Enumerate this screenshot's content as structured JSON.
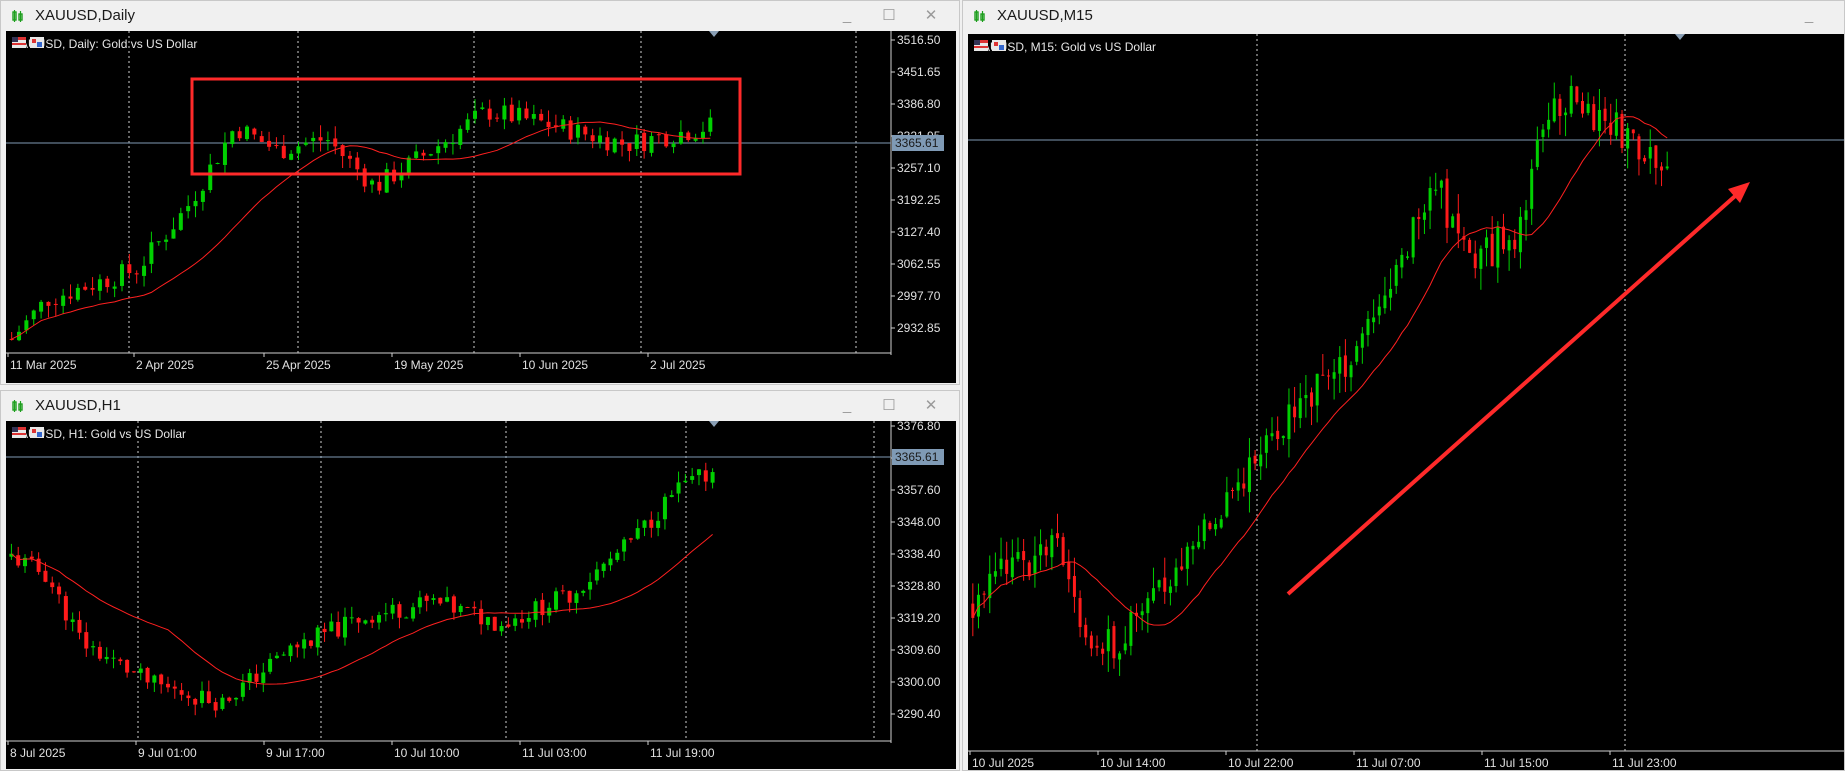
{
  "windows": {
    "daily": {
      "title": "XAUUSD,Daily",
      "legend": "XAUUSD, Daily:  Gold vs US Dollar",
      "price_label": "3365.61",
      "y_ticks": [
        "3516.50",
        "3451.65",
        "3386.80",
        "3321.95",
        "3257.10",
        "3192.25",
        "3127.40",
        "3062.55",
        "2997.70",
        "2932.85"
      ],
      "x_ticks": [
        "11 Mar 2025",
        "2 Apr 2025",
        "25 Apr 2025",
        "19 May 2025",
        "10 Jun 2025",
        "2 Jul 2025"
      ]
    },
    "h1": {
      "title": "XAUUSD,H1",
      "legend": "XAUUSD, H1:  Gold vs US Dollar",
      "price_label": "3365.61",
      "y_ticks": [
        "3376.80",
        "3367.20",
        "3357.60",
        "3348.00",
        "3338.40",
        "3328.80",
        "3319.20",
        "3309.60",
        "3300.00",
        "3290.40"
      ],
      "x_ticks": [
        "8 Jul 2025",
        "9 Jul 01:00",
        "9 Jul 17:00",
        "10 Jul 10:00",
        "11 Jul 03:00",
        "11 Jul 19:00"
      ]
    },
    "m15": {
      "title": "XAUUSD,M15",
      "legend": "XAUUSD, M15:  Gold vs US Dollar",
      "x_ticks": [
        "10 Jul 2025",
        "10 Jul 14:00",
        "10 Jul 22:00",
        "11 Jul 07:00",
        "11 Jul 15:00",
        "11 Jul 23:00"
      ]
    }
  },
  "controls": {
    "minimize": "_",
    "maximize": "☐",
    "close": "✕"
  },
  "colors": {
    "bull": "#00d000",
    "bear": "#ff1a1a",
    "ma": "#ff2020",
    "grid": "#cfcfcf",
    "annotation": "#ff2a2a"
  },
  "icons": {
    "window": "candles-icon",
    "legend": "flag-icon"
  }
}
